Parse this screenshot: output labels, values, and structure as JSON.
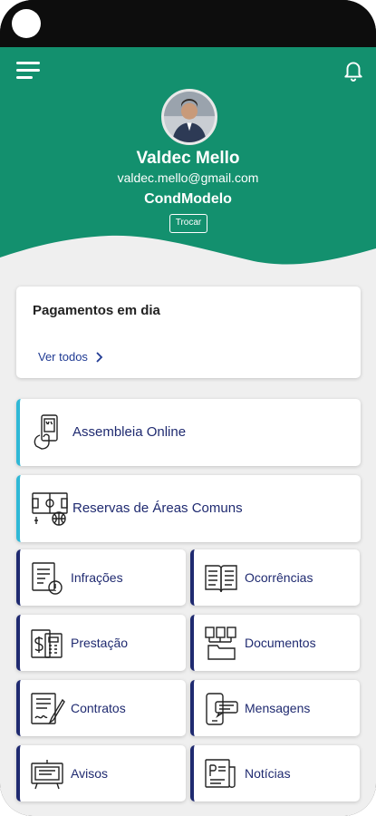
{
  "colors": {
    "brand_green": "#13906e",
    "accent_cyan": "#2fb8d6",
    "navy": "#1f2a70",
    "background": "#efefef"
  },
  "header": {
    "menu_icon": "hamburger-menu-icon",
    "bell_icon": "bell-icon",
    "user_name": "Valdec Mello",
    "user_email": "valdec.mello@gmail.com",
    "condo_name": "CondModelo",
    "switch_label": "Trocar"
  },
  "payments": {
    "title": "Pagamentos em dia",
    "link_label": "Ver todos"
  },
  "features": [
    {
      "label": "Assembleia Online",
      "icon": "online-assembly-icon"
    },
    {
      "label": "Reservas de Áreas Comuns",
      "icon": "common-areas-icon"
    }
  ],
  "tiles": [
    {
      "label": "Infrações",
      "icon": "infractions-icon"
    },
    {
      "label": "Ocorrências",
      "icon": "occurrences-book-icon"
    },
    {
      "label": "Prestação",
      "icon": "accounting-icon"
    },
    {
      "label": "Documentos",
      "icon": "documents-folder-icon"
    },
    {
      "label": "Contratos",
      "icon": "contracts-icon"
    },
    {
      "label": "Mensagens",
      "icon": "messages-icon"
    },
    {
      "label": "Avisos",
      "icon": "notices-board-icon"
    },
    {
      "label": "Notícias",
      "icon": "news-icon"
    }
  ]
}
